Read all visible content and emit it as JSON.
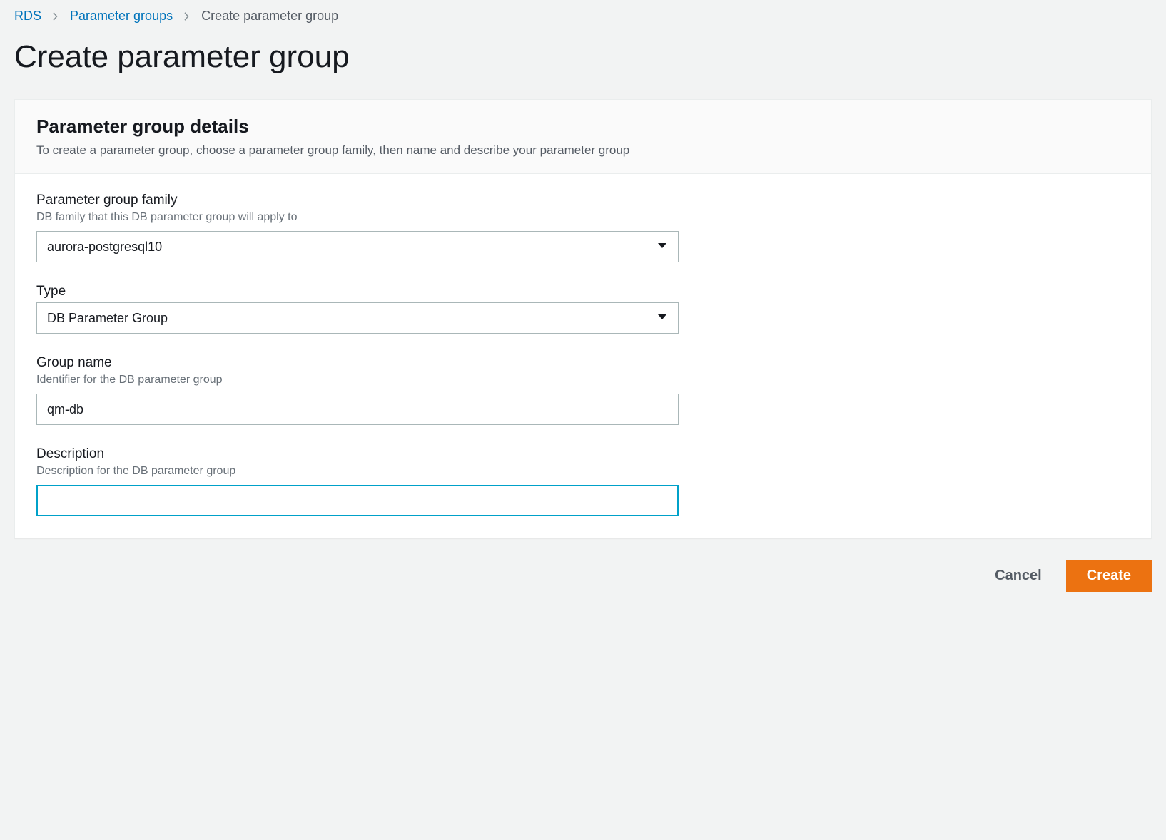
{
  "breadcrumb": {
    "root": "RDS",
    "parent": "Parameter groups",
    "current": "Create parameter group"
  },
  "page": {
    "title": "Create parameter group"
  },
  "panel": {
    "title": "Parameter group details",
    "subtitle": "To create a parameter group, choose a parameter group family, then name and describe your parameter group"
  },
  "form": {
    "family": {
      "label": "Parameter group family",
      "hint": "DB family that this DB parameter group will apply to",
      "value": "aurora-postgresql10"
    },
    "type": {
      "label": "Type",
      "value": "DB Parameter Group"
    },
    "group_name": {
      "label": "Group name",
      "hint": "Identifier for the DB parameter group",
      "value": "qm-db"
    },
    "description": {
      "label": "Description",
      "hint": "Description for the DB parameter group",
      "value": ""
    }
  },
  "actions": {
    "cancel": "Cancel",
    "create": "Create"
  }
}
